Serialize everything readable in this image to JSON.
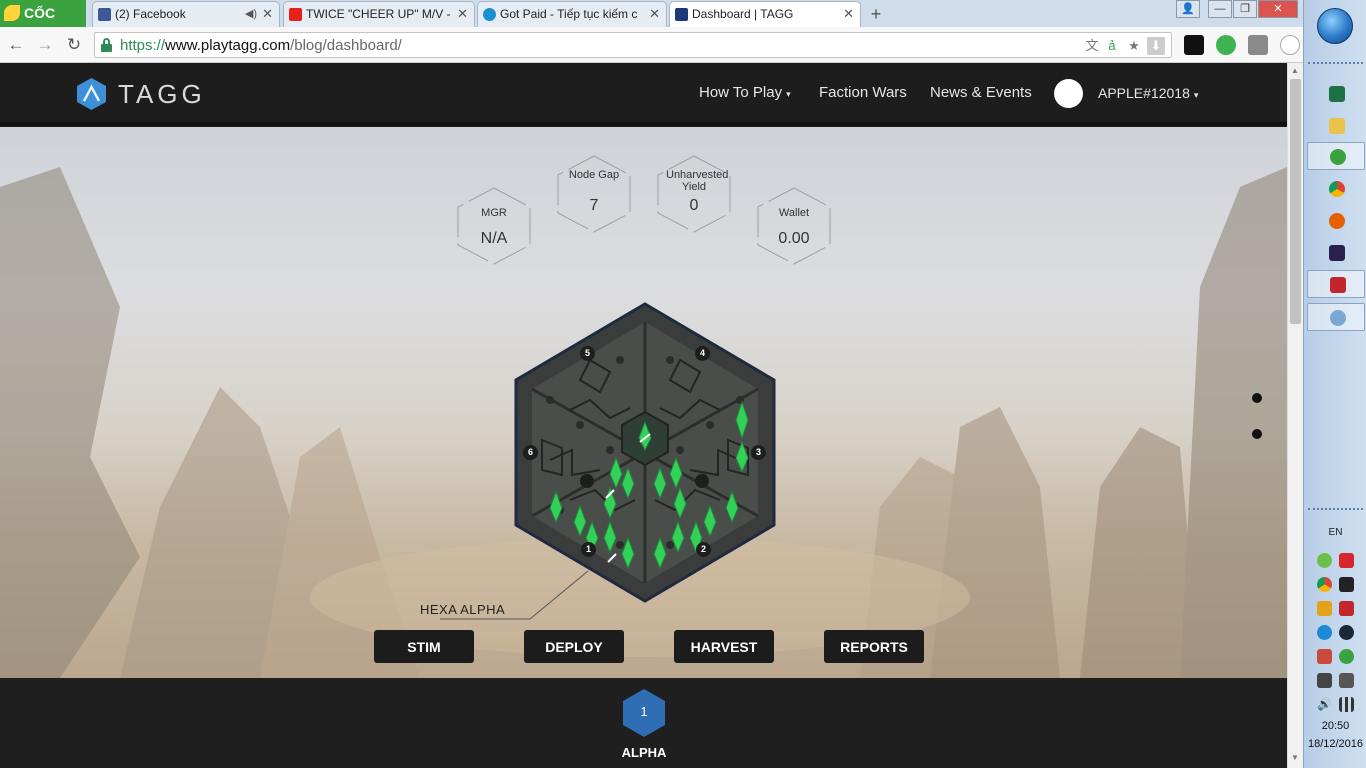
{
  "browser": {
    "brand": "CỐC CỐC",
    "tabs": [
      {
        "title": "(2) Facebook",
        "favicon": "facebook-icon",
        "color": "#3b5998"
      },
      {
        "title": "TWICE \"CHEER UP\" M/V - ",
        "favicon": "youtube-icon",
        "color": "#e62117"
      },
      {
        "title": "Got Paid - Tiếp tục kiếm c",
        "favicon": "skype-icon",
        "color": "#1a8fd1"
      },
      {
        "title": "Dashboard | TAGG",
        "favicon": "tagg-icon",
        "color": "#1b3a7a"
      }
    ],
    "url": {
      "scheme": "https://",
      "host": "www.playtagg.com",
      "path": "/blog/dashboard/"
    }
  },
  "site": {
    "logo": "TAGG",
    "nav": [
      {
        "label": "How To Play",
        "caret": "▾"
      },
      {
        "label": "Faction Wars"
      },
      {
        "label": "News & Events"
      }
    ],
    "user": {
      "name": "APPLE#12018",
      "caret": "▾"
    }
  },
  "stats": {
    "mgr": {
      "label": "MGR",
      "value": "N/A"
    },
    "node_gap": {
      "label": "Node Gap",
      "value": "7"
    },
    "unharvested": {
      "label": "Unharvested Yield",
      "value": "0"
    },
    "wallet": {
      "label": "Wallet",
      "value": "0.00"
    }
  },
  "hexa": {
    "label": "HEXA ALPHA",
    "sectors": [
      "1",
      "2",
      "3",
      "4",
      "5",
      "6"
    ]
  },
  "actions": {
    "stim": "STIM",
    "deploy": "DEPLOY",
    "harvest": "HARVEST",
    "reports": "REPORTS"
  },
  "bottom": {
    "badge_number": "1",
    "badge_name": "ALPHA",
    "badge_color": "#2f6db5"
  },
  "taskbar": {
    "lang": "EN",
    "time": "20:50",
    "date": "18/12/2016"
  }
}
